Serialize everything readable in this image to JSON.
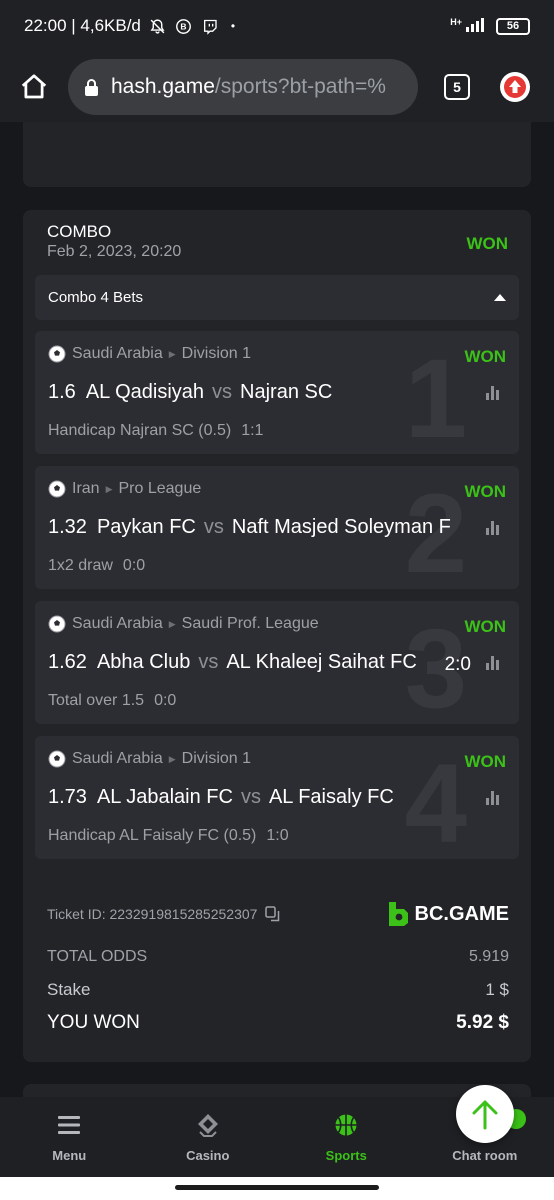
{
  "status_bar": {
    "time_speed": "22:00 | 4,6KB/d",
    "dot": "•",
    "network": "H+",
    "battery": "56"
  },
  "browser": {
    "url_host": "hash.game",
    "url_path": "/sports?bt-path=%",
    "tab_count": "5"
  },
  "bet": {
    "type": "COMBO",
    "date": "Feb 2, 2023, 20:20",
    "status": "WON",
    "combo_label": "Combo 4 Bets",
    "legs": [
      {
        "number": "1",
        "country": "Saudi Arabia",
        "league": "Division 1",
        "status": "WON",
        "odds": "1.6",
        "home": "AL Qadisiyah",
        "vs": "vs",
        "away": "Najran SC",
        "score_right": "",
        "pick": "Handicap Najran SC (0.5)",
        "score": "1:1"
      },
      {
        "number": "2",
        "country": "Iran",
        "league": "Pro League",
        "status": "WON",
        "odds": "1.32",
        "home": "Paykan FC",
        "vs": "vs",
        "away": "Naft Masjed Soleyman F",
        "score_right": "",
        "pick": "1x2 draw",
        "score": "0:0"
      },
      {
        "number": "3",
        "country": "Saudi Arabia",
        "league": "Saudi Prof. League",
        "status": "WON",
        "odds": "1.62",
        "home": "Abha Club",
        "vs": "vs",
        "away": "AL Khaleej Saihat FC",
        "score_right": "2:0",
        "pick": "Total over 1.5",
        "score": "0:0"
      },
      {
        "number": "4",
        "country": "Saudi Arabia",
        "league": "Division 1",
        "status": "WON",
        "odds": "1.73",
        "home": "AL Jabalain FC",
        "vs": "vs",
        "away": "AL Faisaly FC",
        "score_right": "",
        "pick": "Handicap AL Faisaly FC (0.5)",
        "score": "1:0"
      }
    ],
    "ticket_id": "Ticket ID: 2232919815285252307",
    "brand": "BC.GAME",
    "summary": {
      "total_odds_label": "TOTAL ODDS",
      "total_odds": "5.919",
      "stake_label": "Stake",
      "stake": "1 $",
      "won_label": "YOU WON",
      "won": "5.92 $"
    }
  },
  "nav": {
    "menu": "Menu",
    "casino": "Casino",
    "sports": "Sports",
    "chat": "Chat room"
  },
  "colors": {
    "accent_green": "#3bc117",
    "card_bg": "#232428",
    "leg_bg": "#2c2d32"
  }
}
